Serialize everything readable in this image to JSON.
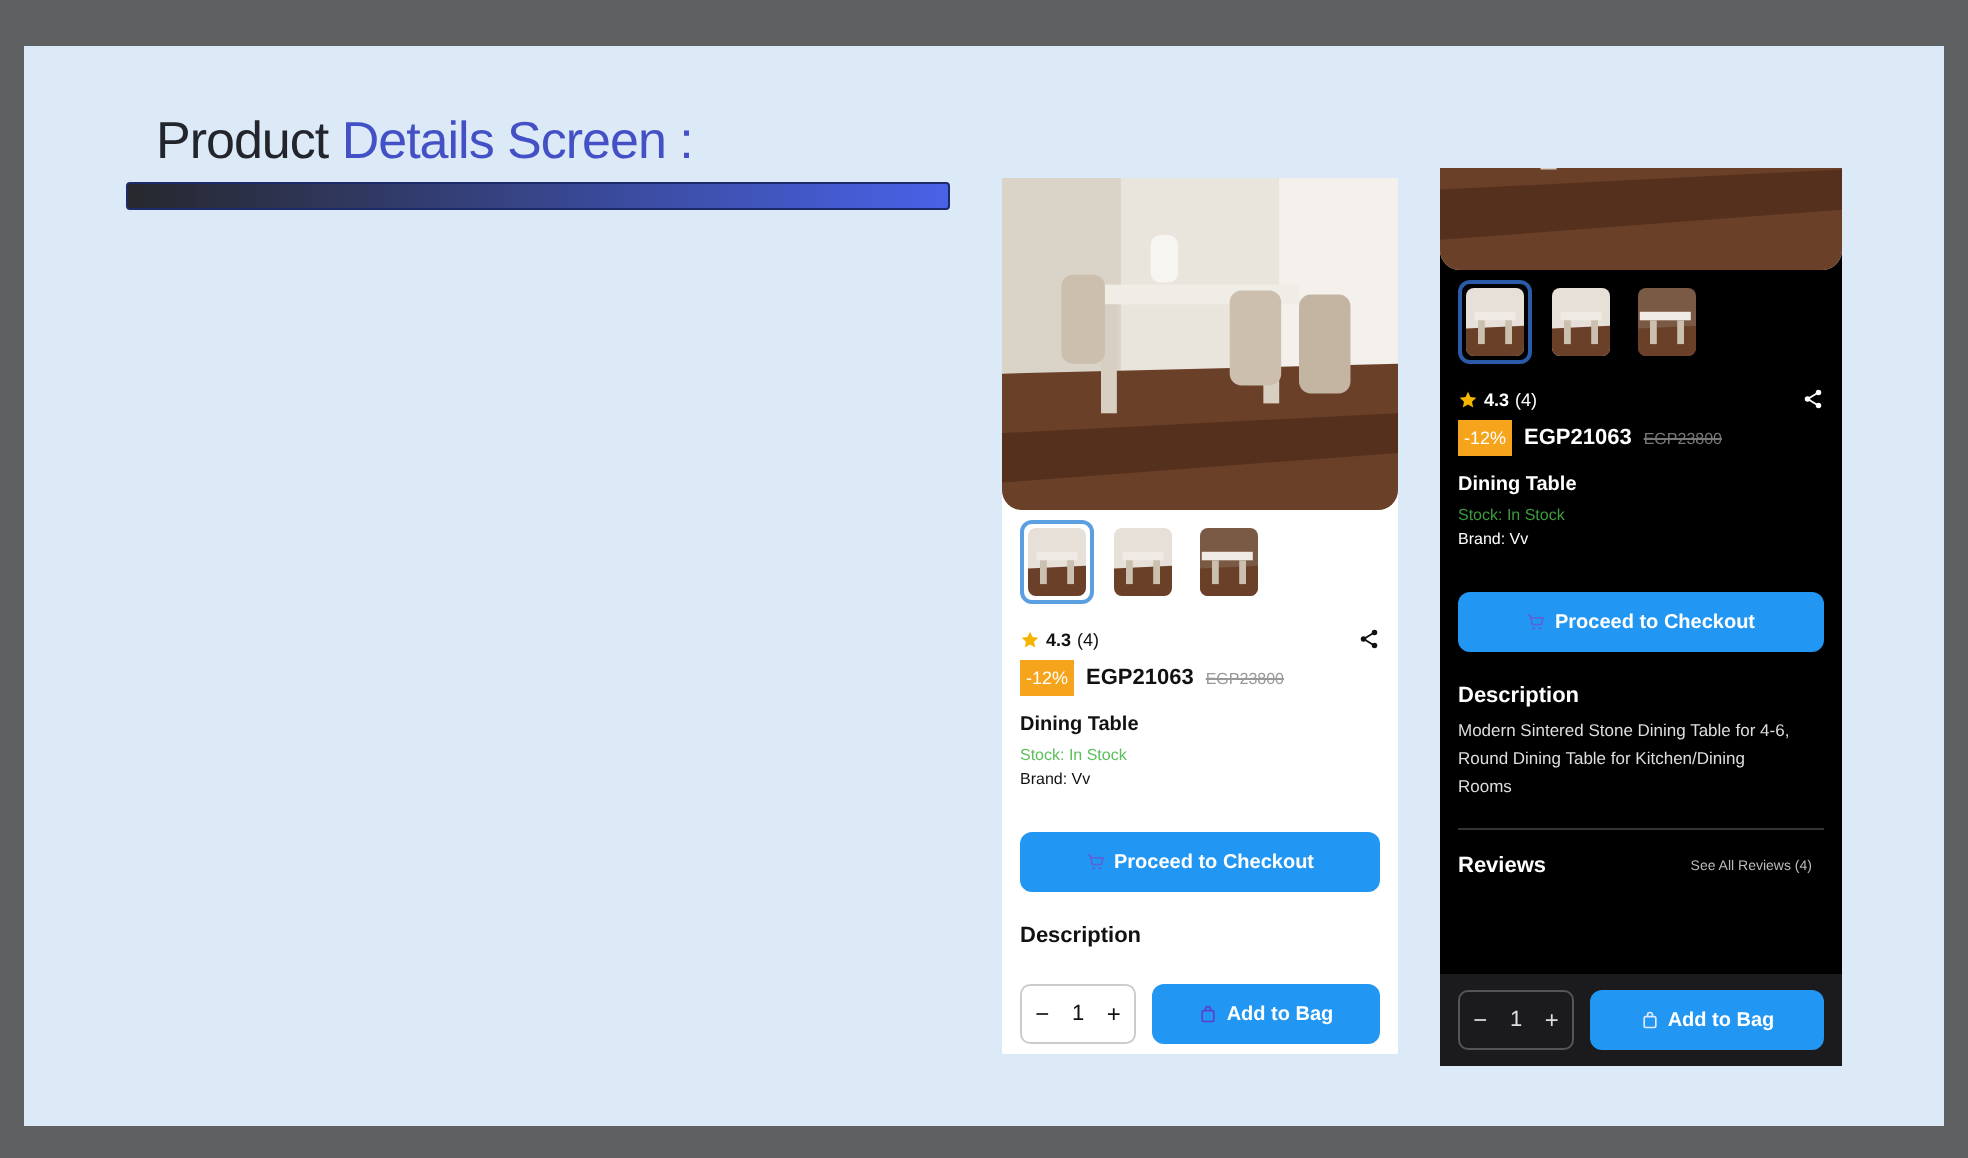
{
  "slide_title": {
    "lead": "Product",
    "rest": "Details Screen :"
  },
  "screens": [
    {
      "dark": false,
      "thumbnails": [
        {
          "selected": true
        },
        {
          "selected": false
        },
        {
          "selected": false
        }
      ],
      "rating": "4.3",
      "rating_count": "(4)",
      "discount": "-12%",
      "price": "EGP21063",
      "old_price": "EGP23800",
      "name": "Dining Table",
      "stock": "Stock: In Stock",
      "brand": "Brand: Vv",
      "checkout_button": "Proceed to Checkout",
      "description_heading": "Description",
      "quantity": {
        "minus": "−",
        "value": "1",
        "plus": "+"
      },
      "add_button": "Add to Bag"
    },
    {
      "dark": true,
      "thumbnails": [
        {
          "selected": true
        },
        {
          "selected": false
        },
        {
          "selected": false
        }
      ],
      "rating": "4.3",
      "rating_count": "(4)",
      "discount": "-12%",
      "price": "EGP21063",
      "old_price": "EGP23800",
      "name": "Dining Table",
      "stock": "Stock: In Stock",
      "brand": "Brand: Vv",
      "checkout_button": "Proceed to Checkout",
      "description_heading": "Description",
      "description": "Modern Sintered Stone Dining Table for 4-6, Round Dining Table for Kitchen/Dining Rooms",
      "reviews_heading": "Reviews",
      "reviews_link": "See All Reviews (4)",
      "quantity": {
        "minus": "−",
        "value": "1",
        "plus": "+"
      },
      "add_button": "Add to Bag"
    }
  ]
}
